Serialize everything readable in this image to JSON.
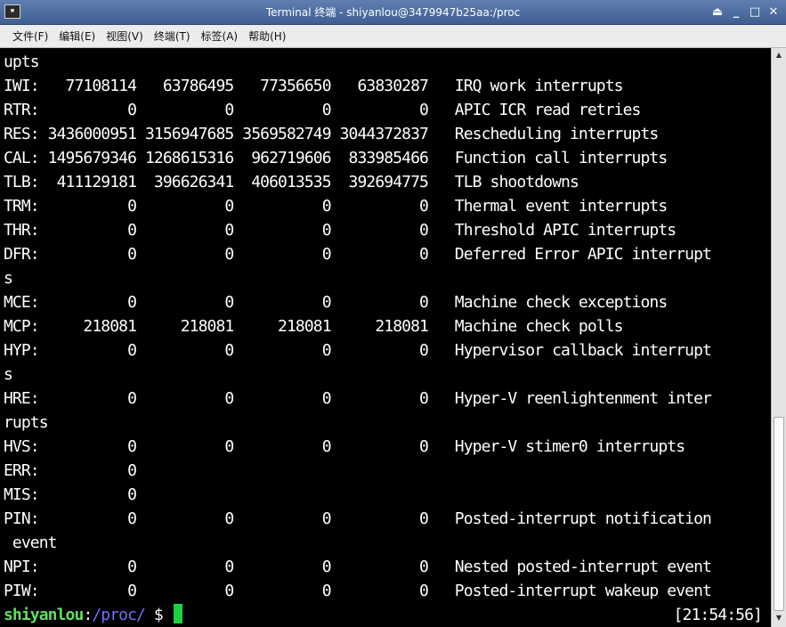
{
  "window": {
    "title": "Terminal 终端 - shiyanlou@3479947b25aa:/proc",
    "app_icon": "terminal-icon",
    "controls": [
      "⏏",
      "_",
      "□",
      "✕"
    ]
  },
  "menu": [
    "文件(F)",
    "编辑(E)",
    "视图(V)",
    "终端(T)",
    "标签(A)",
    "帮助(H)"
  ],
  "terminal": {
    "lines": [
      "upts",
      "IWI:   77108114   63786495   77356650   63830287   IRQ work interrupts",
      "RTR:          0          0          0          0   APIC ICR read retries",
      "RES: 3436000951 3156947685 3569582749 3044372837   Rescheduling interrupts",
      "CAL: 1495679346 1268615316  962719606  833985466   Function call interrupts",
      "TLB:  411129181  396626341  406013535  392694775   TLB shootdowns",
      "TRM:          0          0          0          0   Thermal event interrupts",
      "THR:          0          0          0          0   Threshold APIC interrupts",
      "DFR:          0          0          0          0   Deferred Error APIC interrupt",
      "s",
      "MCE:          0          0          0          0   Machine check exceptions",
      "MCP:     218081     218081     218081     218081   Machine check polls",
      "HYP:          0          0          0          0   Hypervisor callback interrupt",
      "s",
      "HRE:          0          0          0          0   Hyper-V reenlightenment inter",
      "rupts",
      "HVS:          0          0          0          0   Hyper-V stimer0 interrupts",
      "ERR:          0",
      "MIS:          0",
      "PIN:          0          0          0          0   Posted-interrupt notification",
      " event",
      "NPI:          0          0          0          0   Nested posted-interrupt event",
      "PIW:          0          0          0          0   Posted-interrupt wakeup event"
    ],
    "prompt_user": "shiyanlou",
    "prompt_sep": ":",
    "prompt_path": "/proc/",
    "prompt_dollar": " $ ",
    "clock": "[21:54:56]",
    "colors": {
      "background": "#000000",
      "text": "#ffffff",
      "prompt_user": "#5fe05f",
      "prompt_path": "#6f6fff",
      "cursor": "#1fd13f"
    }
  },
  "scrollbar": {
    "up_arrow": "▲",
    "down_arrow": "▼"
  }
}
